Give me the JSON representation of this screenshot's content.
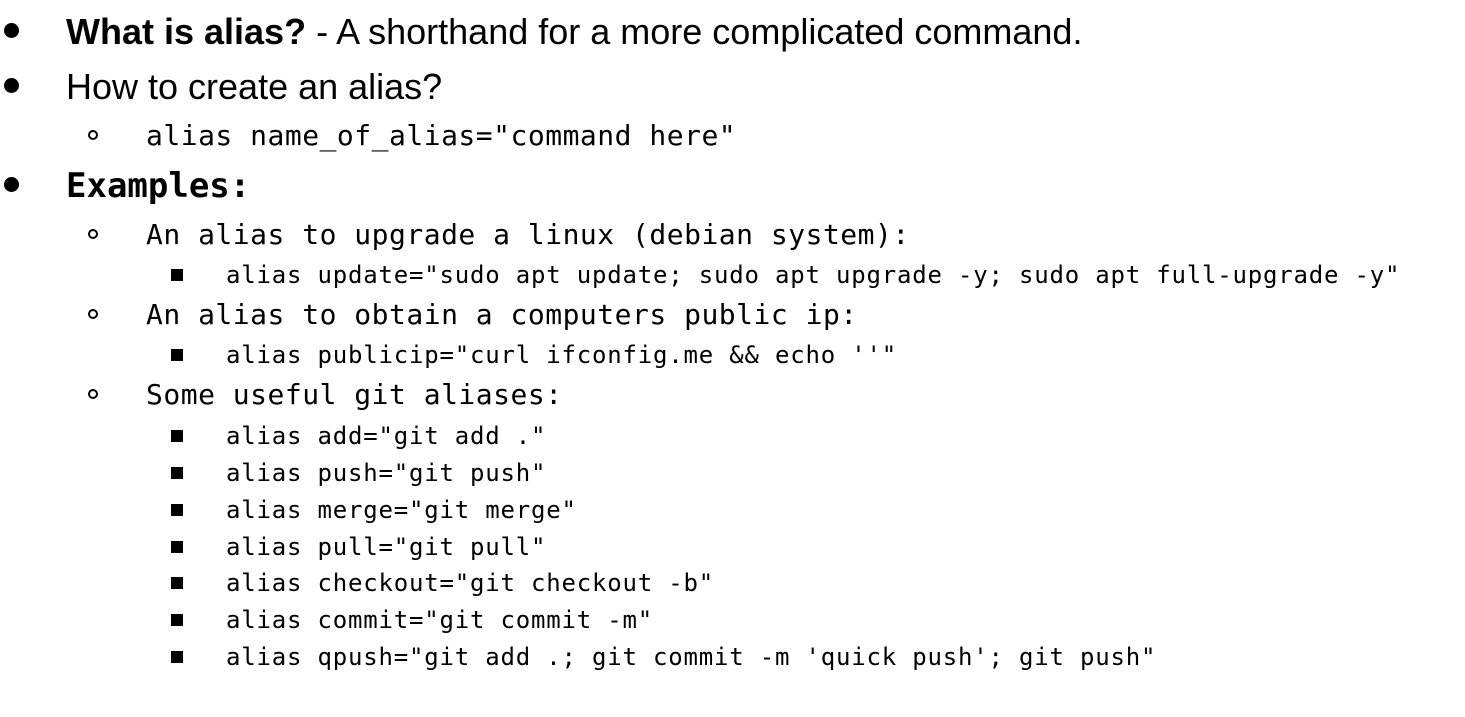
{
  "what_is": {
    "term": "What is alias?",
    "definition": " - A shorthand for a more complicated command."
  },
  "how_to": {
    "question": "How to create an alias?",
    "syntax": "alias name_of_alias=\"command here\""
  },
  "examples": {
    "heading": "Examples:",
    "groups": [
      {
        "description": "An alias to upgrade a linux (debian system):",
        "commands": [
          "alias update=\"sudo apt update; sudo apt upgrade -y; sudo apt full-upgrade -y\""
        ]
      },
      {
        "description": "An alias to obtain a computers public ip:",
        "commands": [
          "alias publicip=\"curl ifconfig.me && echo ''\""
        ]
      },
      {
        "description": "Some useful git aliases:",
        "commands": [
          "alias add=\"git add .\"",
          "alias push=\"git push\"",
          "alias merge=\"git merge\"",
          "alias pull=\"git pull\"",
          "alias checkout=\"git checkout -b\"",
          "alias commit=\"git commit -m\"",
          "alias qpush=\"git add .; git commit -m 'quick push'; git push\""
        ]
      }
    ]
  }
}
